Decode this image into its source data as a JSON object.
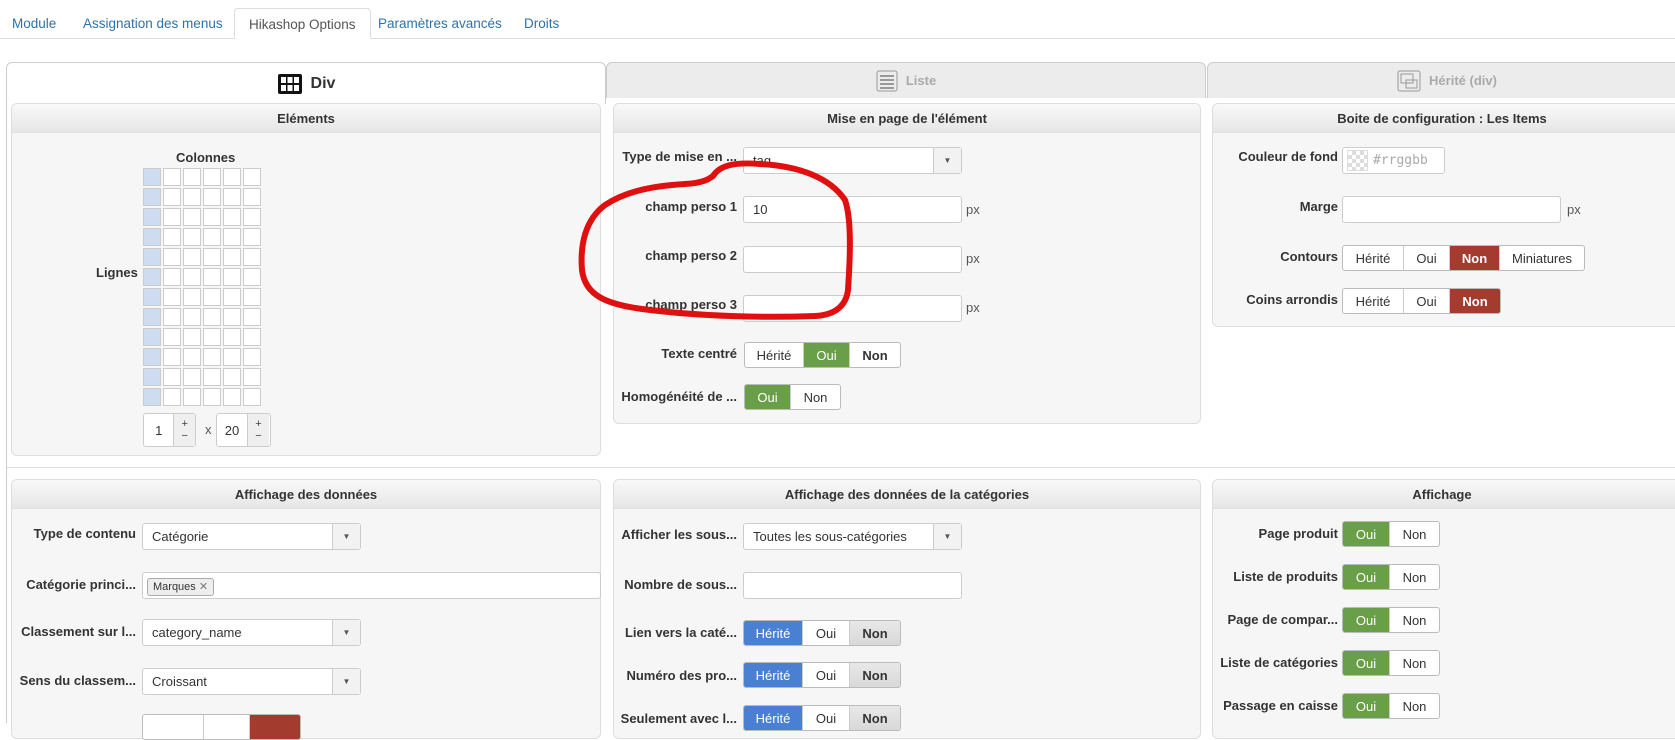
{
  "tabs": [
    {
      "label": "Module"
    },
    {
      "label": "Assignation des menus"
    },
    {
      "label": "Hikashop Options",
      "active": true
    },
    {
      "label": "Paramètres avancés"
    },
    {
      "label": "Droits"
    }
  ],
  "layout_tabs": [
    {
      "label": "Div",
      "icon": "grid-layout-icon",
      "active": true
    },
    {
      "label": "Liste",
      "icon": "list-layout-icon"
    },
    {
      "label": "Hérité (div)",
      "icon": "inherit-layout-icon"
    }
  ],
  "colors": {
    "green": "#6a9f4a",
    "red": "#a33b2e",
    "blue": "#4a80d3",
    "annotation": "#e01010"
  },
  "elements": {
    "title": "Eléments",
    "columns_label": "Colonnes",
    "rows_label": "Lignes",
    "columns": "1",
    "rows": "20",
    "x": "x",
    "plus": "+",
    "minus": "−"
  },
  "layout": {
    "title": "Mise en page de l'élément",
    "type_label": "Type de mise en ...",
    "type_value": "tag",
    "field1_label": "champ perso 1",
    "field1_value": "10",
    "field2_label": "champ perso 2",
    "field2_value": "",
    "field3_label": "champ perso 3",
    "field3_value": "",
    "unit": "px",
    "centered_label": "Texte centré",
    "homog_label": "Homogénéité de ...",
    "opt_inherit": "Hérité",
    "opt_yes": "Oui",
    "opt_no": "Non"
  },
  "config": {
    "title": "Boite de configuration : Les Items",
    "bg_label": "Couleur de fond",
    "bg_placeholder": "#rrggbb",
    "margin_label": "Marge",
    "unit": "px",
    "borders_label": "Contours",
    "corners_label": "Coins arrondis",
    "opt_inherit": "Hérité",
    "opt_yes": "Oui",
    "opt_no": "Non",
    "opt_thumbs": "Miniatures"
  },
  "data_display": {
    "title": "Affichage des données",
    "content_label": "Type de contenu",
    "content_value": "Catégorie",
    "main_cat_label": "Catégorie princi...",
    "main_cat_tag": "Marques",
    "sort_label": "Classement sur l...",
    "sort_value": "category_name",
    "order_label": "Sens du classem...",
    "order_value": "Croissant"
  },
  "cat_display": {
    "title": "Affichage des données de la catégories",
    "sub_label": "Afficher les sous...",
    "sub_value": "Toutes les sous-catégories",
    "count_label": "Nombre de sous...",
    "count_value": "",
    "link_label": "Lien vers la caté...",
    "num_label": "Numéro des pro...",
    "only_label": "Seulement avec l...",
    "opt_inherit": "Hérité",
    "opt_yes": "Oui",
    "opt_no": "Non"
  },
  "display": {
    "title": "Affichage",
    "rows": [
      {
        "label": "Page produit"
      },
      {
        "label": "Liste de produits"
      },
      {
        "label": "Page de compar..."
      },
      {
        "label": "Liste de catégories"
      },
      {
        "label": "Passage en caisse"
      }
    ],
    "opt_yes": "Oui",
    "opt_no": "Non"
  }
}
